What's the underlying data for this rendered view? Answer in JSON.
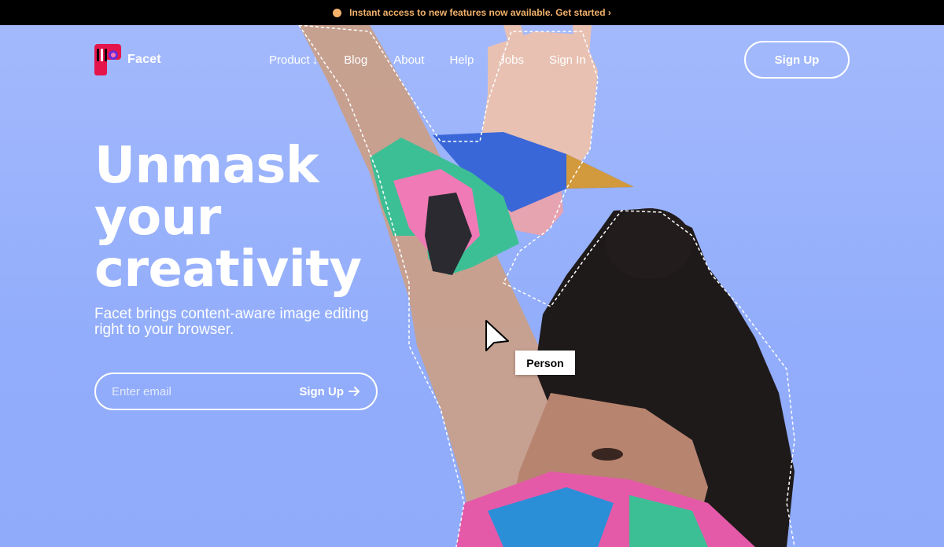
{
  "announcement": {
    "text": "Instant access to new features now available. Get started ›",
    "accent_color": "#f3b26b"
  },
  "brand": {
    "name": "Facet",
    "logo_icon": "facet-logo-icon"
  },
  "nav": {
    "items": [
      {
        "label": "Product",
        "icon": "arrow-down-icon"
      },
      {
        "label": "Blog"
      },
      {
        "label": "About"
      },
      {
        "label": "Help"
      },
      {
        "label": "Jobs"
      },
      {
        "label": "Sign In"
      }
    ],
    "signup_label": "Sign Up"
  },
  "hero": {
    "headline_line1": "Unmask",
    "headline_line2": "your",
    "headline_line3": "creativity",
    "subtext": "Facet brings content-aware image editing right to your browser.",
    "background_color": "#a3b8fb"
  },
  "email_form": {
    "placeholder": "Enter email",
    "submit_label": "Sign Up",
    "submit_icon": "arrow-right-icon"
  },
  "selection": {
    "label": "Person",
    "cursor_icon": "cursor-icon"
  }
}
